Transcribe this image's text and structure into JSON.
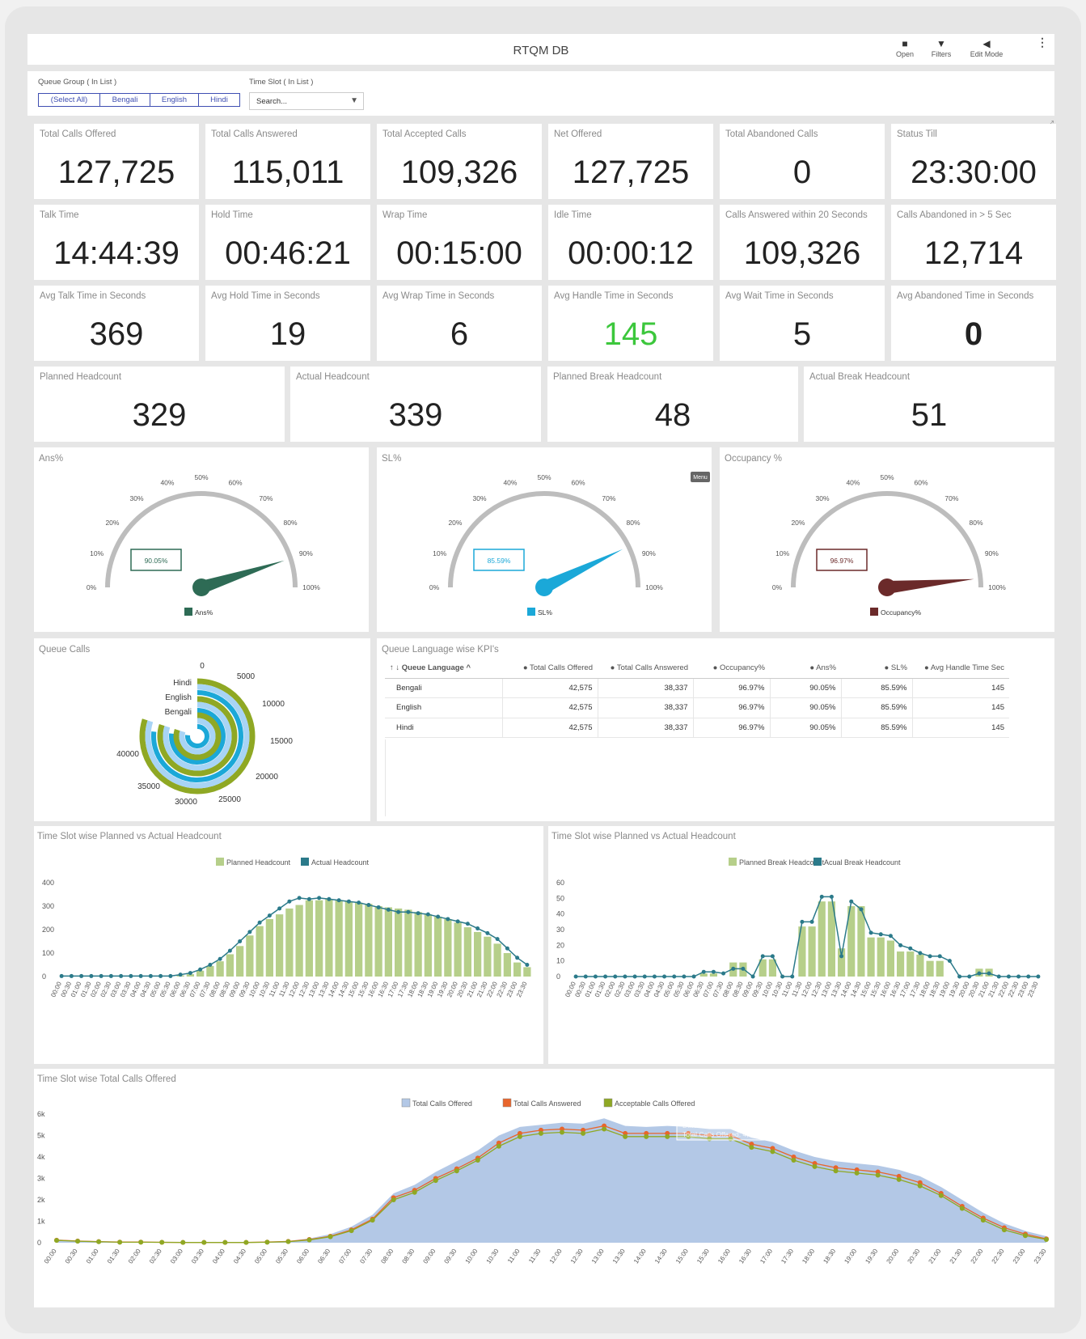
{
  "header": {
    "title": "RTQM DB",
    "tools": [
      {
        "label": "Open",
        "icon": "folder-icon"
      },
      {
        "label": "Filters",
        "icon": "filter-icon"
      },
      {
        "label": "Edit Mode",
        "icon": "pencil-icon"
      }
    ]
  },
  "filters": {
    "queue_group_label": "Queue Group ( In List )",
    "queue_options": [
      "(Select All)",
      "Bengali",
      "English",
      "Hindi"
    ],
    "time_slot_label": "Time Slot ( In List )",
    "time_slot_placeholder": "Search..."
  },
  "kpis": [
    {
      "label": "Total Calls Offered",
      "value": "127,725"
    },
    {
      "label": "Total Calls Answered",
      "value": "115,011"
    },
    {
      "label": "Total Accepted Calls",
      "value": "109,326"
    },
    {
      "label": "Net Offered",
      "value": "127,725"
    },
    {
      "label": "Total Abandoned Calls",
      "value": "0"
    },
    {
      "label": "Status Till",
      "value": "23:30:00"
    },
    {
      "label": "Talk Time",
      "value": "14:44:39"
    },
    {
      "label": "Hold Time",
      "value": "00:46:21"
    },
    {
      "label": "Wrap Time",
      "value": "00:15:00"
    },
    {
      "label": "Idle Time",
      "value": "00:00:12"
    },
    {
      "label": "Calls Answered within 20 Seconds",
      "value": "109,326"
    },
    {
      "label": "Calls Abandoned in > 5 Sec",
      "value": "12,714"
    },
    {
      "label": "Avg Talk Time in Seconds",
      "value": "369"
    },
    {
      "label": "Avg Hold Time in Seconds",
      "value": "19"
    },
    {
      "label": "Avg Wrap Time in Seconds",
      "value": "6"
    },
    {
      "label": "Avg Handle Time in Seconds",
      "value": "145",
      "color": "#3cc73c"
    },
    {
      "label": "Avg Wait Time in Seconds",
      "value": "5"
    },
    {
      "label": "Avg Abandoned Time in Seconds",
      "value": "0",
      "bold": true
    }
  ],
  "headcount": [
    {
      "label": "Planned Headcount",
      "value": "329"
    },
    {
      "label": "Actual Headcount",
      "value": "339"
    },
    {
      "label": "Planned Break Headcount",
      "value": "48"
    },
    {
      "label": "Actual Break Headcount",
      "value": "51"
    }
  ],
  "gauges": [
    {
      "title": "Ans%",
      "value": 90.05,
      "display": "90.05%",
      "color": "#2e6b55",
      "legend": "Ans%"
    },
    {
      "title": "SL%",
      "value": 85.59,
      "display": "85.59%",
      "color": "#1ba8d8",
      "legend": "SL%",
      "menu": "Menu"
    },
    {
      "title": "Occupancy %",
      "value": 96.97,
      "display": "96.97%",
      "color": "#6b2a2a",
      "legend": "Occupancy%"
    }
  ],
  "gauge_ticks": [
    "0%",
    "10%",
    "20%",
    "30%",
    "40%",
    "50%",
    "60%",
    "70%",
    "80%",
    "90%",
    "100%"
  ],
  "queue_calls": {
    "title": "Queue Calls",
    "ticks": [
      "0",
      "5000",
      "10000",
      "15000",
      "20000",
      "25000",
      "30000",
      "35000",
      "40000"
    ],
    "max": 40000,
    "rings": [
      {
        "name": "Hindi",
        "offered": 42575,
        "answered": 38337
      },
      {
        "name": "English",
        "offered": 42575,
        "answered": 38337
      },
      {
        "name": "Bengali",
        "offered": 42575,
        "answered": 38337
      }
    ],
    "colors": {
      "outer": "#8fa824",
      "mid": "#a8d4f5",
      "inner": "#1ba8d8"
    }
  },
  "kpi_table": {
    "title": "Queue Language wise KPI's",
    "columns": [
      "↑ ↓ Queue Language ^",
      "● Total Calls Offered",
      "● Total Calls Answered",
      "● Occupancy%",
      "● Ans%",
      "● SL%",
      "● Avg Handle Time Sec"
    ],
    "rows": [
      [
        "Bengali",
        "42,575",
        "38,337",
        "96.97%",
        "90.05%",
        "85.59%",
        "145"
      ],
      [
        "English",
        "42,575",
        "38,337",
        "96.97%",
        "90.05%",
        "85.59%",
        "145"
      ],
      [
        "Hindi",
        "42,575",
        "38,337",
        "96.97%",
        "90.05%",
        "85.59%",
        "145"
      ]
    ]
  },
  "chart_data": [
    {
      "type": "bar",
      "title": "Time Slot wise Planned vs Actual Headcount",
      "legend": [
        "Planned Headcount",
        "Actual Headcount"
      ],
      "colors": [
        "#b6cf8a",
        "#2b7a8a"
      ],
      "yticks": [
        0,
        100,
        200,
        300,
        400
      ],
      "ylim": [
        0,
        400
      ],
      "categories": [
        "00:00",
        "00:30",
        "01:00",
        "01:30",
        "02:00",
        "02:30",
        "03:00",
        "03:30",
        "04:00",
        "04:30",
        "05:00",
        "05:30",
        "06:00",
        "06:30",
        "07:00",
        "07:30",
        "08:00",
        "08:30",
        "09:00",
        "09:30",
        "10:00",
        "10:30",
        "11:00",
        "11:30",
        "12:00",
        "12:30",
        "13:00",
        "13:30",
        "14:00",
        "14:30",
        "15:00",
        "15:30",
        "16:00",
        "16:30",
        "17:00",
        "17:30",
        "18:00",
        "18:30",
        "19:00",
        "19:30",
        "20:00",
        "20:30",
        "21:00",
        "21:30",
        "22:00",
        "22:30",
        "23:00",
        "23:30"
      ],
      "series": [
        {
          "name": "Planned Headcount",
          "values": [
            0,
            0,
            0,
            0,
            0,
            0,
            0,
            0,
            0,
            0,
            0,
            0,
            5,
            10,
            25,
            45,
            65,
            95,
            130,
            175,
            215,
            245,
            265,
            290,
            305,
            325,
            325,
            330,
            325,
            320,
            315,
            310,
            300,
            295,
            290,
            285,
            275,
            265,
            255,
            245,
            230,
            210,
            190,
            170,
            140,
            100,
            60,
            40
          ]
        },
        {
          "name": "Actual Headcount",
          "values": [
            2,
            2,
            2,
            2,
            2,
            2,
            2,
            2,
            2,
            2,
            2,
            2,
            8,
            15,
            30,
            50,
            75,
            110,
            150,
            190,
            230,
            260,
            290,
            320,
            335,
            330,
            335,
            330,
            325,
            320,
            315,
            305,
            295,
            285,
            275,
            275,
            270,
            265,
            255,
            245,
            235,
            225,
            205,
            185,
            160,
            120,
            80,
            50
          ]
        }
      ]
    },
    {
      "type": "bar",
      "title": "Time Slot wise Planned vs Actual Headcount",
      "legend": [
        "Planned Break Headcount",
        "Acual Break Headcount"
      ],
      "colors": [
        "#b6cf8a",
        "#2b7a8a"
      ],
      "yticks": [
        0,
        10,
        20,
        30,
        40,
        50,
        60
      ],
      "ylim": [
        0,
        60
      ],
      "categories": [
        "00:00",
        "00:30",
        "01:00",
        "01:30",
        "02:00",
        "02:30",
        "03:00",
        "03:30",
        "04:00",
        "04:30",
        "05:00",
        "05:30",
        "06:00",
        "06:30",
        "07:00",
        "07:30",
        "08:00",
        "08:30",
        "09:00",
        "09:30",
        "10:00",
        "10:30",
        "11:00",
        "11:30",
        "12:00",
        "12:30",
        "13:00",
        "13:30",
        "14:00",
        "14:30",
        "15:00",
        "15:30",
        "16:00",
        "16:30",
        "17:00",
        "17:30",
        "18:00",
        "18:30",
        "19:00",
        "19:30",
        "20:00",
        "20:30",
        "21:00",
        "21:30",
        "22:00",
        "22:30",
        "23:00",
        "23:30"
      ],
      "series": [
        {
          "name": "Planned Break Headcount",
          "values": [
            0,
            0,
            0,
            0,
            0,
            0,
            0,
            0,
            0,
            0,
            0,
            0,
            0,
            2,
            2,
            0,
            9,
            9,
            0,
            11,
            11,
            0,
            0,
            32,
            32,
            48,
            48,
            18,
            45,
            45,
            25,
            25,
            23,
            16,
            16,
            14,
            10,
            10,
            0,
            0,
            0,
            5,
            5,
            0,
            0,
            0,
            0,
            0
          ]
        },
        {
          "name": "Acual Break Headcount",
          "values": [
            0,
            0,
            0,
            0,
            0,
            0,
            0,
            0,
            0,
            0,
            0,
            0,
            0,
            3,
            3,
            2,
            5,
            5,
            0,
            13,
            13,
            0,
            0,
            35,
            35,
            51,
            51,
            13,
            48,
            43,
            28,
            27,
            26,
            20,
            18,
            15,
            13,
            13,
            10,
            0,
            0,
            2,
            2,
            0,
            0,
            0,
            0,
            0
          ]
        }
      ]
    },
    {
      "type": "area",
      "title": "Time Slot wise Total Calls Offered",
      "legend": [
        "Total Calls Offered",
        "Total Calls Answered",
        "Acceptable Calls Offered"
      ],
      "colors": [
        "#b3c8e6",
        "#e8652c",
        "#8fa824"
      ],
      "yticks": [
        "0",
        "1k",
        "2k",
        "3k",
        "4k",
        "5k",
        "6k"
      ],
      "ylim": [
        0,
        6000
      ],
      "categories": [
        "00:00",
        "00:30",
        "01:00",
        "01:30",
        "02:00",
        "02:30",
        "03:00",
        "03:30",
        "04:00",
        "04:30",
        "05:00",
        "05:30",
        "06:00",
        "06:30",
        "07:00",
        "07:30",
        "08:00",
        "08:30",
        "09:00",
        "09:30",
        "10:00",
        "10:30",
        "11:00",
        "11:30",
        "12:00",
        "12:30",
        "13:00",
        "13:30",
        "14:00",
        "14:30",
        "15:00",
        "15:30",
        "16:00",
        "16:30",
        "17:00",
        "17:30",
        "18:00",
        "18:30",
        "19:00",
        "19:30",
        "20:00",
        "20:30",
        "21:00",
        "21:30",
        "22:00",
        "22:30",
        "23:00",
        "23:30"
      ],
      "series": [
        {
          "name": "Total Calls Offered",
          "values": [
            150,
            100,
            60,
            40,
            40,
            30,
            20,
            20,
            20,
            20,
            40,
            80,
            200,
            400,
            750,
            1300,
            2300,
            2700,
            3300,
            3800,
            4300,
            5000,
            5400,
            5500,
            5600,
            5550,
            5800,
            5450,
            5400,
            5450,
            5400,
            5300,
            5300,
            4900,
            4700,
            4300,
            4000,
            3800,
            3700,
            3600,
            3400,
            3100,
            2600,
            2000,
            1400,
            900,
            550,
            300
          ]
        },
        {
          "name": "Total Calls Answered",
          "values": [
            120,
            80,
            50,
            30,
            30,
            20,
            15,
            15,
            15,
            15,
            30,
            60,
            150,
            300,
            600,
            1100,
            2100,
            2450,
            3000,
            3450,
            3950,
            4650,
            5100,
            5250,
            5300,
            5250,
            5450,
            5100,
            5100,
            5100,
            5100,
            5000,
            5000,
            4600,
            4400,
            4000,
            3700,
            3500,
            3400,
            3300,
            3100,
            2800,
            2300,
            1700,
            1150,
            700,
            400,
            180
          ]
        },
        {
          "name": "Acceptable Calls Offered",
          "values": [
            110,
            70,
            45,
            25,
            25,
            18,
            12,
            12,
            12,
            12,
            25,
            50,
            130,
            280,
            560,
            1050,
            2000,
            2350,
            2900,
            3350,
            3850,
            4500,
            4950,
            5100,
            5150,
            5100,
            5300,
            4950,
            4950,
            4950,
            4950,
            4850,
            4850,
            4450,
            4250,
            3850,
            3550,
            3350,
            3250,
            3150,
            2950,
            2650,
            2200,
            1600,
            1050,
            600,
            330,
            150
          ]
        }
      ],
      "tooltip": [
        "Date - Time Slot :   17:00",
        "Total Calls Offered: 4,548"
      ]
    }
  ]
}
